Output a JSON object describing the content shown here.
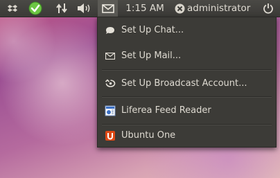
{
  "panel": {
    "time": "1:15 AM",
    "user": "administrator",
    "icons": [
      "dropbox-icon",
      "update-check-icon",
      "network-arrows-icon",
      "volume-icon",
      "mail-envelope-icon",
      "user-status-icon",
      "power-icon"
    ]
  },
  "messaging_menu": {
    "items": [
      {
        "label": "Set Up Chat...",
        "icon": "chat-bubble-icon"
      },
      {
        "label": "Set Up Mail...",
        "icon": "envelope-icon"
      },
      {
        "label": "Set Up Broadcast Account...",
        "icon": "broadcast-icon"
      },
      {
        "label": "Liferea Feed Reader",
        "icon": "feed-reader-icon"
      },
      {
        "label": "Ubuntu One",
        "icon": "ubuntu-one-icon"
      }
    ]
  },
  "colors": {
    "panel_bg": "#3c3b37",
    "menu_bg": "#3c3b37",
    "text": "#dfdbd2",
    "ubuntu_one_orange": "#dd4814",
    "check_green": "#6cc644"
  }
}
